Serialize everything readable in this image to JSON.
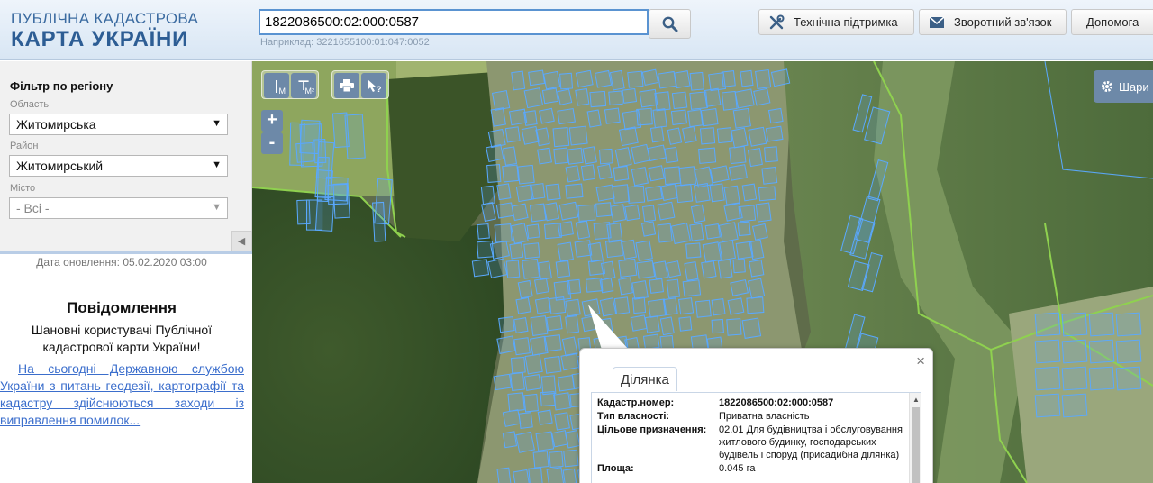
{
  "header": {
    "logo_line1": "ПУБЛІЧНА КАДАСТРОВА",
    "logo_line2": "КАРТА УКРАЇНИ",
    "search_value": "1822086500:02:000:0587",
    "search_hint": "Наприклад: 3221655100:01:047:0052",
    "buttons": {
      "support": "Технічна підтримка",
      "feedback": "Зворотний зв'язок",
      "help": "Допомога"
    }
  },
  "sidebar": {
    "filter_title": "Фільтр по регіону",
    "oblast_label": "Область",
    "oblast_value": "Житомирська",
    "raion_label": "Район",
    "raion_value": "Житомирський",
    "city_label": "Місто",
    "city_value": "- Всі -",
    "update_date": "Дата оновлення: 05.02.2020 03:00",
    "notice_title": "Повідомлення",
    "notice_text": "Шановні користувачі Публічної кадастрової карти України!",
    "notice_link": "На сьогодні Державною службою України з питань геодезії, картографії та кадастру здійснюються заходи із виправлення помилок..."
  },
  "map": {
    "tools": {
      "measure_length": "M",
      "measure_area": "M²"
    },
    "zoom_in": "+",
    "zoom_out": "-",
    "layers_label": "Шари"
  },
  "popup": {
    "close": "×",
    "tab_label": "Ділянка",
    "attributes": [
      {
        "label": "Кадастр.номер:",
        "value": "1822086500:02:000:0587",
        "bold": true
      },
      {
        "label": "Тип власності:",
        "value": "Приватна власність",
        "bold": false
      },
      {
        "label": "Цільове призначення:",
        "value": "02.01 Для будівництва і обслуговування житлового будинку, господарських будівель і споруд (присадибна ділянка)",
        "bold": false
      },
      {
        "label": "Площа:",
        "value": "0.045 га",
        "bold": false
      }
    ]
  },
  "colors": {
    "parcel_outline": "#5aa9ff",
    "boundary_green": "#8fd14f",
    "tool_bg": "#6d89a8"
  }
}
